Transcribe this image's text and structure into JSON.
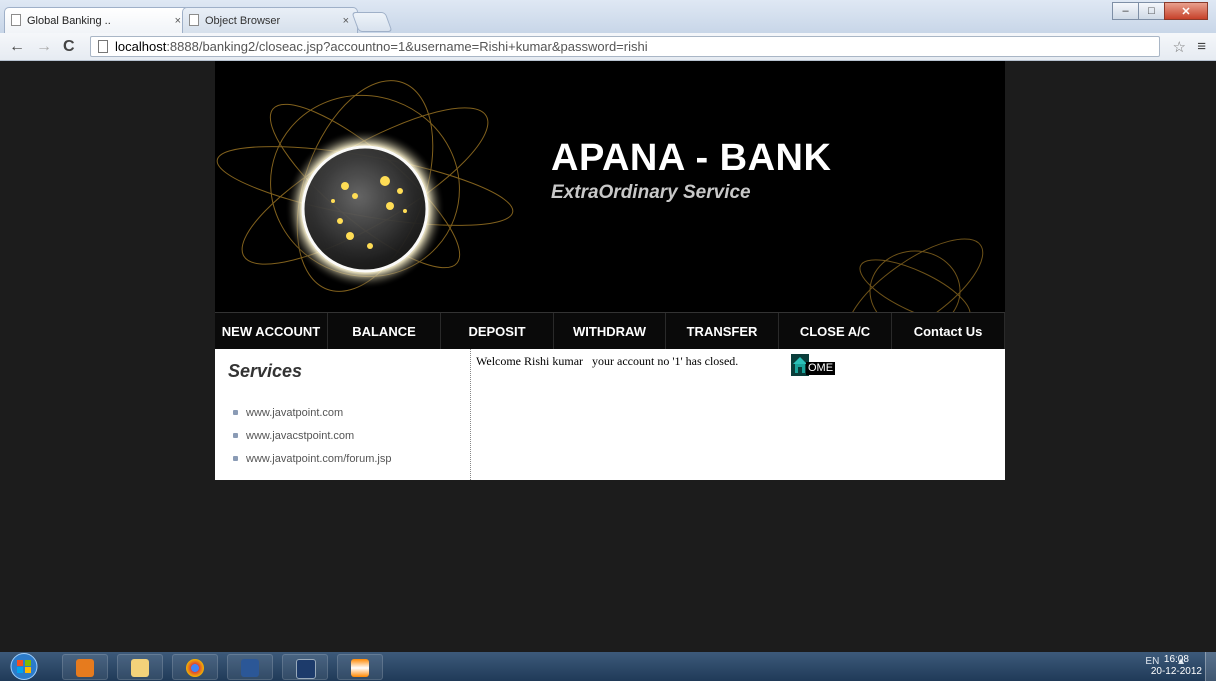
{
  "browser": {
    "tabs": [
      {
        "title": "Global Banking ..",
        "close": "×"
      },
      {
        "title": "Object Browser",
        "close": "×"
      }
    ],
    "url_host": "localhost",
    "url_rest": ":8888/banking2/closeac.jsp?accountno=1&username=Rishi+kumar&password=rishi"
  },
  "header": {
    "bank_name": "APANA - BANK",
    "tagline": "ExtraOrdinary Service"
  },
  "nav": [
    {
      "label": "NEW ACCOUNT",
      "width": 113
    },
    {
      "label": "BALANCE",
      "width": 113
    },
    {
      "label": "DEPOSIT",
      "width": 113
    },
    {
      "label": "WITHDRAW",
      "width": 112
    },
    {
      "label": "TRANSFER",
      "width": 113
    },
    {
      "label": "CLOSE A/C",
      "width": 113
    },
    {
      "label": "Contact Us",
      "width": 113
    }
  ],
  "sidebar": {
    "title": "Services",
    "links": [
      "www.javatpoint.com",
      "www.javacstpoint.com",
      "www.javatpoint.com/forum.jsp"
    ]
  },
  "main": {
    "message": "Welcome Rishi kumar   your account no '1' has closed.",
    "home_label": "OME"
  },
  "taskbar": {
    "lang": "EN",
    "time": "16:08",
    "date": "20-12-2012"
  },
  "colors": {
    "page_bg": "#1c1c1c",
    "banner_bg": "#000000",
    "nav_bg": "#0a0a0a",
    "content_bg": "#ffffff"
  }
}
